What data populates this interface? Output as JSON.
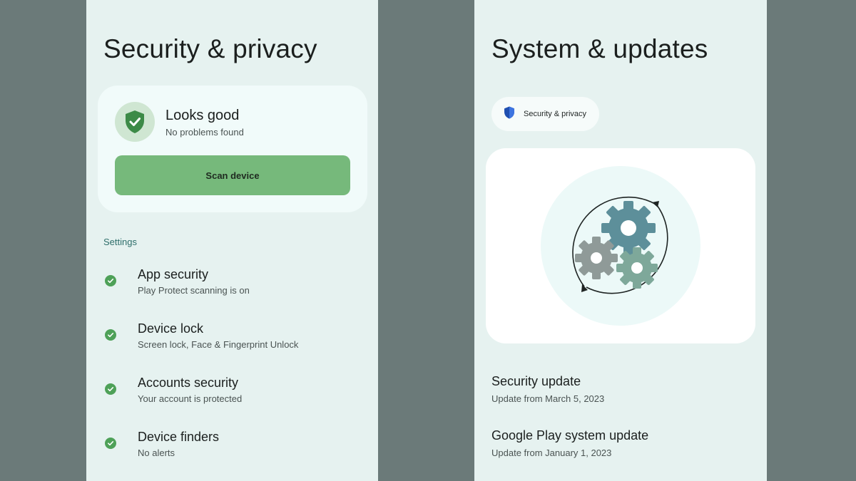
{
  "left_screen": {
    "title": "Security & privacy",
    "status_card": {
      "title": "Looks good",
      "subtitle": "No problems found",
      "scan_button_label": "Scan device"
    },
    "section_header": "Settings",
    "items": [
      {
        "title": "App security",
        "subtitle": "Play Protect scanning is on"
      },
      {
        "title": "Device lock",
        "subtitle": "Screen lock, Face & Fingerprint Unlock"
      },
      {
        "title": "Accounts security",
        "subtitle": "Your account is protected"
      },
      {
        "title": "Device finders",
        "subtitle": "No alerts"
      }
    ]
  },
  "right_screen": {
    "title": "System & updates",
    "chip_label": "Security & privacy",
    "updates": [
      {
        "title": "Security update",
        "subtitle": "Update from March 5, 2023"
      },
      {
        "title": "Google Play system update",
        "subtitle": "Update from January 1, 2023"
      }
    ]
  },
  "icons": {
    "status": "shield-check-icon",
    "item_status": "check-circle-icon",
    "chip": "blue-shield-icon",
    "illustration": "gears-sync-icon"
  },
  "colors": {
    "screen_bg": "#e6f2f0",
    "outer_bg": "#6b7a79",
    "accent_green": "#76b97b",
    "check_green": "#4ea158",
    "shield_green": "#3c8a47",
    "chip_shield_blue": "#1f4fb0"
  }
}
